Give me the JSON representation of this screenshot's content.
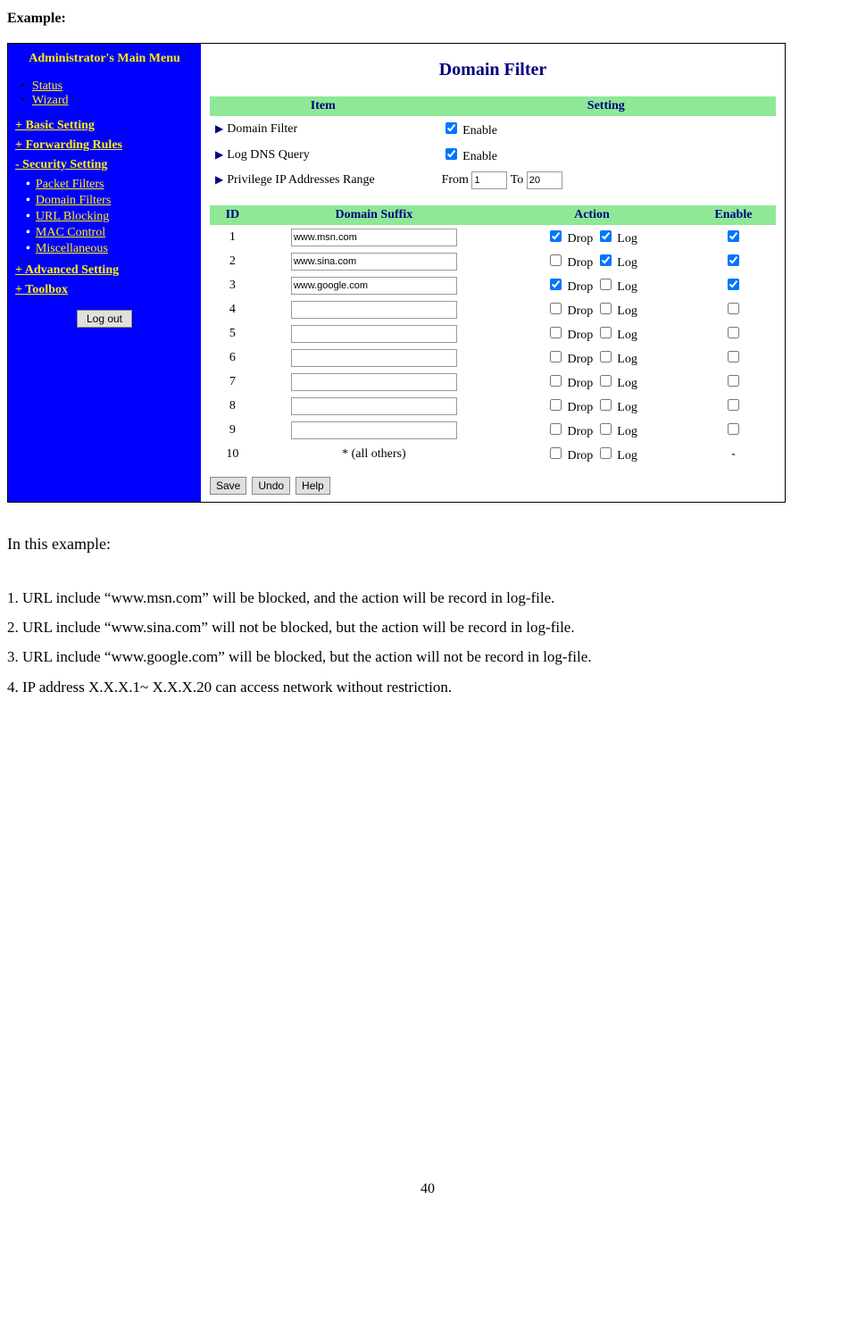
{
  "heading": "Example:",
  "sidebar": {
    "title": "Administrator's Main Menu",
    "top_links": [
      "Status",
      "Wizard"
    ],
    "cats": [
      {
        "label": "+ Basic Setting",
        "items": []
      },
      {
        "label": "+ Forwarding Rules",
        "items": []
      },
      {
        "label": "- Security Setting",
        "items": [
          "Packet Filters",
          "Domain Filters",
          "URL Blocking",
          "MAC Control",
          "Miscellaneous"
        ]
      },
      {
        "label": "+ Advanced Setting",
        "items": []
      },
      {
        "label": "+ Toolbox",
        "items": []
      }
    ],
    "logout": "Log out"
  },
  "main": {
    "title": "Domain Filter",
    "header_cols": [
      "Item",
      "Setting"
    ],
    "items": [
      {
        "label": "Domain Filter",
        "type": "checkbox",
        "checked": true,
        "text": "Enable"
      },
      {
        "label": "Log DNS Query",
        "type": "checkbox",
        "checked": true,
        "text": "Enable"
      },
      {
        "label": "Privilege IP Addresses Range",
        "type": "range",
        "from_label": "From",
        "from": "1",
        "to_label": "To",
        "to": "20"
      }
    ],
    "rules_cols": [
      "ID",
      "Domain Suffix",
      "Action",
      "Enable"
    ],
    "action_labels": {
      "drop": "Drop",
      "log": "Log"
    },
    "rules": [
      {
        "id": "1",
        "domain": "www.msn.com",
        "drop": true,
        "log": true,
        "enable": true
      },
      {
        "id": "2",
        "domain": "www.sina.com",
        "drop": false,
        "log": true,
        "enable": true
      },
      {
        "id": "3",
        "domain": "www.google.com",
        "drop": true,
        "log": false,
        "enable": true
      },
      {
        "id": "4",
        "domain": "",
        "drop": false,
        "log": false,
        "enable": false
      },
      {
        "id": "5",
        "domain": "",
        "drop": false,
        "log": false,
        "enable": false
      },
      {
        "id": "6",
        "domain": "",
        "drop": false,
        "log": false,
        "enable": false
      },
      {
        "id": "7",
        "domain": "",
        "drop": false,
        "log": false,
        "enable": false
      },
      {
        "id": "8",
        "domain": "",
        "drop": false,
        "log": false,
        "enable": false
      },
      {
        "id": "9",
        "domain": "",
        "drop": false,
        "log": false,
        "enable": false
      },
      {
        "id": "10",
        "domain_text": "* (all others)",
        "drop": false,
        "log": false,
        "enable_dash": "-"
      }
    ],
    "buttons": [
      "Save",
      "Undo",
      "Help"
    ]
  },
  "footer": {
    "intro": "In this example:",
    "lines": [
      "1. URL include “www.msn.com” will be blocked, and the action will be record in log-file.",
      "2. URL include “www.sina.com” will not be blocked, but the action will be record in log-file.",
      "3. URL include “www.google.com” will be blocked, but the action will not be record in log-file.",
      "4. IP address X.X.X.1~ X.X.X.20 can access network without restriction."
    ],
    "page": "40"
  }
}
